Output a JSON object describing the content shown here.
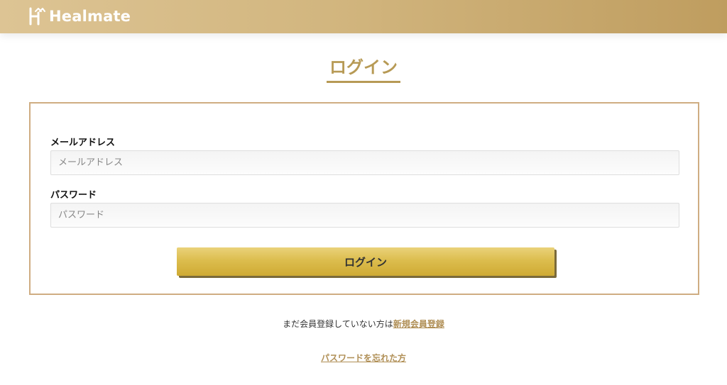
{
  "header": {
    "brand": "Healmate",
    "colors": {
      "gradient_start": "#ddc494",
      "gradient_end": "#bf9d5f"
    }
  },
  "page": {
    "title": "ログイン",
    "accent_color": "#b79a55"
  },
  "form": {
    "email": {
      "label": "メールアドレス",
      "placeholder": "メールアドレス",
      "value": ""
    },
    "password": {
      "label": "パスワード",
      "placeholder": "パスワード",
      "value": ""
    },
    "submit_label": "ログイン",
    "border_color": "#cfad82",
    "button_color": "#dcbd4e"
  },
  "footer": {
    "register_prompt": "まだ会員登録していない方は",
    "register_link": "新規会員登録",
    "forgot_link": "パスワードを忘れた方",
    "link_color": "#b08f56"
  }
}
